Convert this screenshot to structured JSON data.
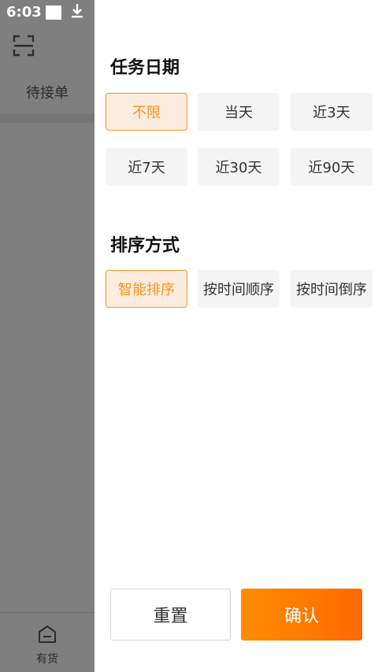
{
  "status_bar": {
    "time": "6:03"
  },
  "left_nav": {
    "pending_label": "待接单",
    "bottom_item_label": "有货"
  },
  "filter": {
    "date_title": "任务日期",
    "date_options": [
      {
        "label": "不限",
        "selected": true
      },
      {
        "label": "当天",
        "selected": false
      },
      {
        "label": "近3天",
        "selected": false
      },
      {
        "label": "近7天",
        "selected": false
      },
      {
        "label": "近30天",
        "selected": false
      },
      {
        "label": "近90天",
        "selected": false
      }
    ],
    "sort_title": "排序方式",
    "sort_options": [
      {
        "label": "智能排序",
        "selected": true
      },
      {
        "label": "按时间顺序",
        "selected": false
      },
      {
        "label": "按时间倒序",
        "selected": false
      }
    ]
  },
  "actions": {
    "reset_label": "重置",
    "confirm_label": "确认"
  },
  "colors": {
    "accent": "#f7941e",
    "confirm_gradient_start": "#ff8c00",
    "confirm_gradient_end": "#ff6a00",
    "overlay": "#7f7f7f"
  }
}
